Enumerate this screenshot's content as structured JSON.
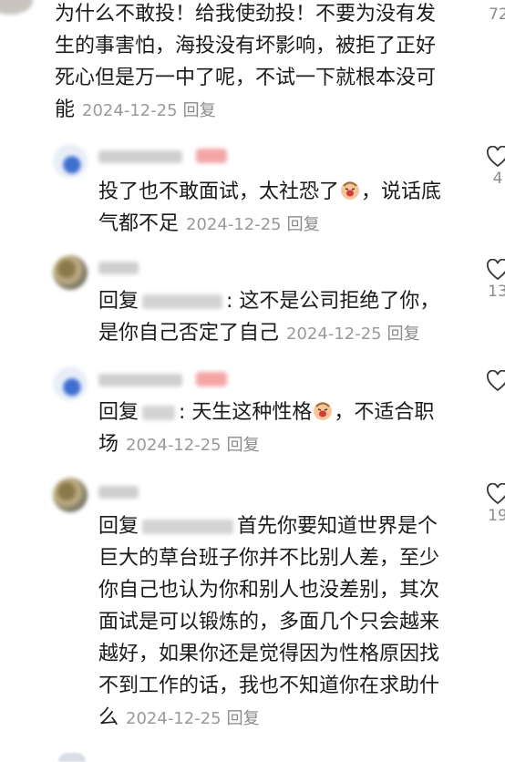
{
  "top_comment": {
    "lines": [
      "为什么不敢投！给我使劲投！不要为没有发",
      "生的事害怕，海投没有坏影响，被拒了正好",
      "死心但是万一中了呢，不试一下就根本没可",
      "能"
    ],
    "date": "2024-12-25",
    "reply_label": "回复",
    "like_count": "72"
  },
  "replies": [
    {
      "text_lines": [
        "投了也不敢面试，太社恐了",
        "，说话底",
        "气都不足"
      ],
      "date": "2024-12-25",
      "reply_label": "回复",
      "like_count": "4"
    },
    {
      "prefix": "回复",
      "text_lines": [
        ": 这不是公司拒绝了你，",
        "是你自己否定了自己"
      ],
      "date": "2024-12-25",
      "reply_label": "回复",
      "like_count": "13"
    },
    {
      "prefix": "回复",
      "text_lines": [
        ": 天生这种性格",
        "，不适合职",
        "场"
      ],
      "date": "2024-12-25",
      "reply_label": "回复",
      "like_count": ""
    },
    {
      "prefix": "回复",
      "text_lines": [
        "首先你要知道世界是个",
        "巨大的草台班子你并不比别人差，至少",
        "你自己也认为你和别人也没差别，其次",
        "面试是可以锻炼的，多面几个只会越来",
        "越好，如果你还是觉得因为性格原因找",
        "不到工作的话，我也不知道你在求助什",
        "么"
      ],
      "date": "2024-12-25",
      "reply_label": "回复",
      "like_count": "19"
    }
  ],
  "icons": {
    "like": "heart-outline-icon",
    "emoji": "crying-face-emoji"
  }
}
